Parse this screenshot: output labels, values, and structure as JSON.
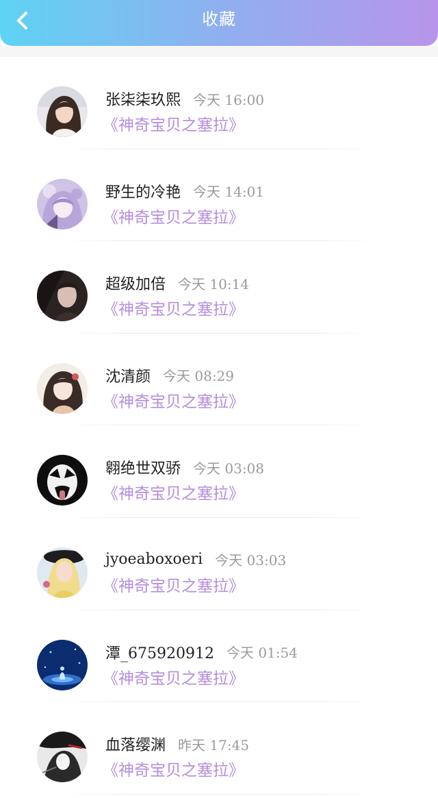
{
  "header": {
    "title": "收藏",
    "back_icon": "chevron-left-icon",
    "gradient": [
      "#5fd3f3",
      "#b895ea"
    ]
  },
  "colors": {
    "book_title": "#b48ede",
    "name": "#222222",
    "time": "#9a9a9a"
  },
  "items": [
    {
      "name": "张柒柒玖熙",
      "time": "今天 16:00",
      "book": "《神奇宝贝之塞拉》",
      "avatar": "girl-portrait"
    },
    {
      "name": "野生的冷艳",
      "time": "今天 14:01",
      "book": "《神奇宝贝之塞拉》",
      "avatar": "anime-purple-hair"
    },
    {
      "name": "超级加倍",
      "time": "今天 10:14",
      "book": "《神奇宝贝之塞拉》",
      "avatar": "dark-portrait"
    },
    {
      "name": "沈清颜",
      "time": "今天 08:29",
      "book": "《神奇宝贝之塞拉》",
      "avatar": "anime-girl-hairpin"
    },
    {
      "name": "翱绝世双骄",
      "time": "今天 03:08",
      "book": "《神奇宝贝之塞拉》",
      "avatar": "kiss-face-paint"
    },
    {
      "name": "jyoeaboxoeri",
      "time": "今天 03:03",
      "book": "《神奇宝贝之塞拉》",
      "avatar": "blonde-hat"
    },
    {
      "name": "潭_675920912",
      "time": "今天 01:54",
      "book": "《神奇宝贝之塞拉》",
      "avatar": "blue-galaxy"
    },
    {
      "name": "血落缨渊",
      "time": "昨天 17:45",
      "book": "《神奇宝贝之塞拉》",
      "avatar": "ink-sketch"
    }
  ]
}
